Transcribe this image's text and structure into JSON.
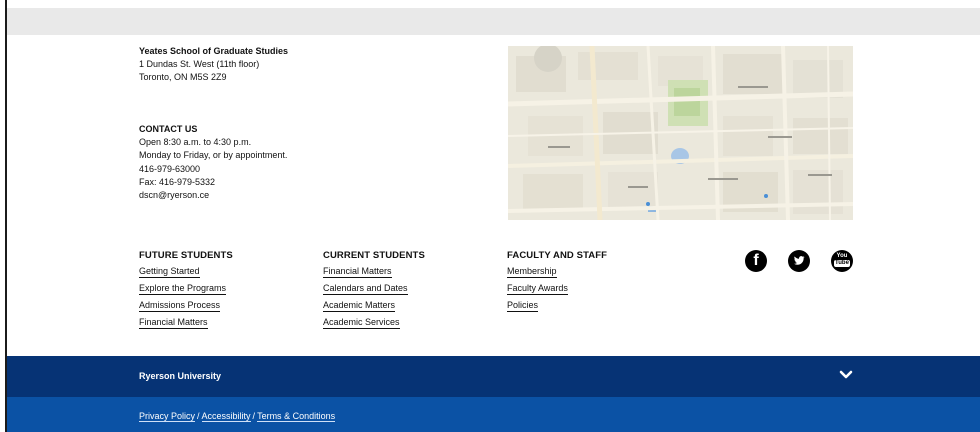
{
  "address": {
    "title": "Yeates School of Graduate Studies",
    "line1": "1 Dundas St. West (11th floor)",
    "line2": "Toronto, ON M5S 2Z9"
  },
  "contact": {
    "heading": "CONTACT US",
    "hours": "Open 8:30 a.m. to 4:30 p.m.",
    "days": "Monday to Friday, or by appointment.",
    "phone": "416-979-63000",
    "fax": "Fax: 416-979-5332",
    "email": "dscn@ryerson.ce"
  },
  "link_columns": [
    {
      "heading": "FUTURE STUDENTS",
      "links": [
        "Getting Started",
        "Explore the Programs",
        "Admissions Process",
        "Financial Matters"
      ]
    },
    {
      "heading": "CURRENT STUDENTS",
      "links": [
        "Financial Matters",
        "Calendars and Dates",
        "Academic Matters",
        "Academic Services"
      ]
    },
    {
      "heading": "FACULTY AND STAFF",
      "links": [
        "Membership",
        "Faculty Awards",
        "Policies"
      ]
    }
  ],
  "social": {
    "facebook_icon": "facebook-icon",
    "twitter_icon": "twitter-icon",
    "youtube_icon": "youtube-icon",
    "youtube_text_1": "You",
    "youtube_text_2": "Tube"
  },
  "footer": {
    "university": "Ryerson University",
    "expand_icon": "chevron-down-icon",
    "legal": [
      "Privacy Policy",
      "Accessibility",
      "Terms & Conditions"
    ],
    "separator": "/"
  },
  "colors": {
    "footer_dark": "#063375",
    "footer_light": "#0b52a5",
    "top_band": "#e9e9e9"
  }
}
